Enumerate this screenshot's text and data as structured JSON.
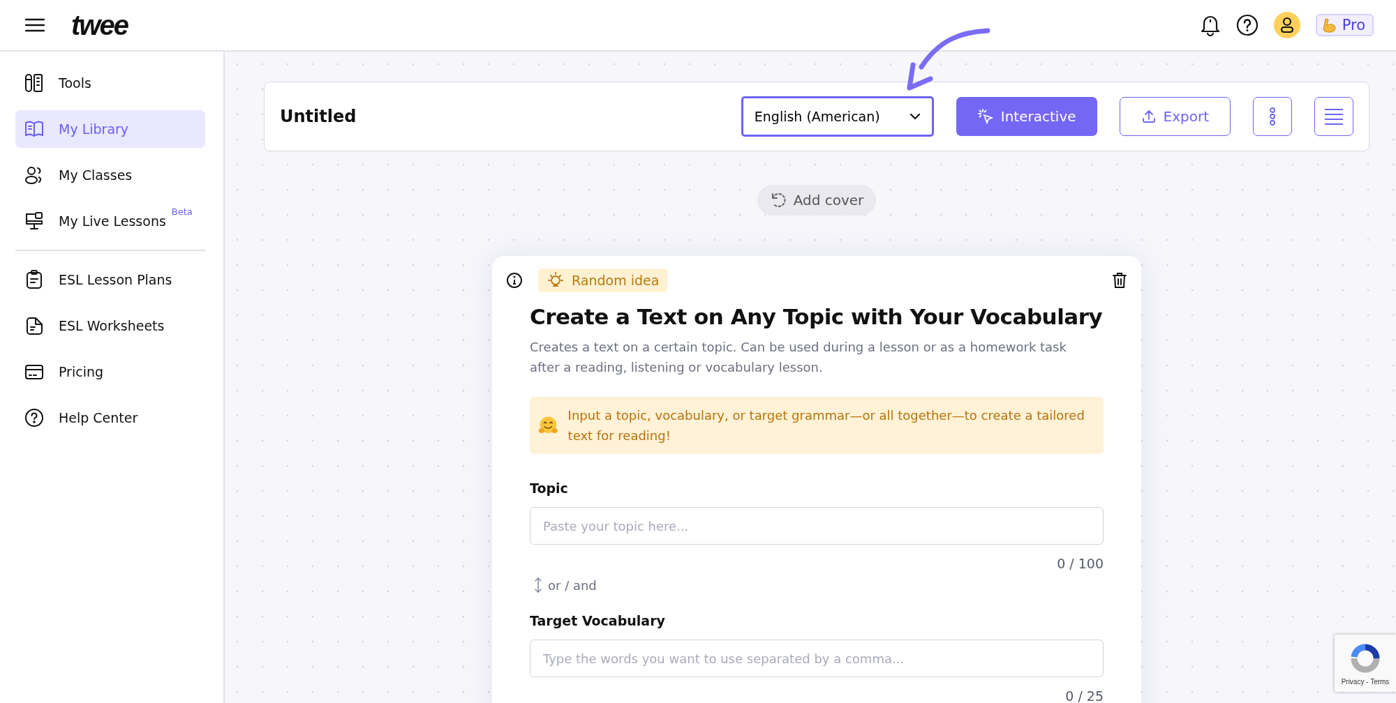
{
  "header": {
    "logo": "twee",
    "pro_badge": "Pro"
  },
  "sidebar": {
    "sections": [
      {
        "items": [
          {
            "kind": "tools",
            "label": "Tools",
            "selected": false
          },
          {
            "kind": "library",
            "label": "My Library",
            "selected": true
          },
          {
            "kind": "classes",
            "label": "My Classes",
            "selected": false
          },
          {
            "kind": "live",
            "label": "My Live Lessons",
            "badge": "Beta",
            "selected": false
          }
        ]
      },
      {
        "items": [
          {
            "kind": "plans",
            "label": "ESL Lesson Plans",
            "selected": false
          },
          {
            "kind": "worksheets",
            "label": "ESL Worksheets",
            "selected": false
          },
          {
            "kind": "pricing",
            "label": "Pricing",
            "selected": false
          },
          {
            "kind": "help",
            "label": "Help Center",
            "selected": false
          }
        ]
      }
    ]
  },
  "toolbar": {
    "title": "Untitled",
    "language": "English (American)",
    "interactive_button": "Interactive",
    "export_button": "Export"
  },
  "add_cover": "Add cover",
  "tool_card": {
    "random_idea": "Random idea",
    "title": "Create a Text on Any Topic with Your Vocabulary",
    "description": "Creates a text on a certain topic. Can be used during a lesson or as a homework task after a reading, listening or vocabulary lesson.",
    "hint": "Input a topic, vocabulary, or target grammar—or all together—to create a tailored text for reading!",
    "separator": "or / and",
    "fields": [
      {
        "label": "Topic",
        "placeholder": "Paste your topic here...",
        "counter": "0 / 100"
      },
      {
        "label": "Target Vocabulary",
        "placeholder": "Type the words you want to use separated by a comma...",
        "counter": "0 / 25"
      }
    ]
  },
  "recaptcha": {
    "links": "Privacy - Terms"
  }
}
